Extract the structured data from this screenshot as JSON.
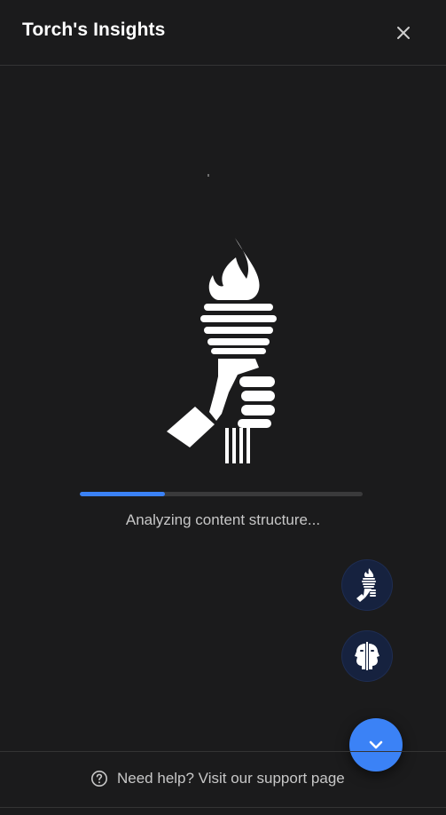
{
  "header": {
    "title": "Torch's Insights",
    "close_icon": "close-icon"
  },
  "loader": {
    "logo_icon": "torch-hand-icon",
    "progress_percent": 30,
    "status_text": "Analyzing content structure..."
  },
  "floating": {
    "avatars": [
      {
        "icon": "torch-avatar-icon"
      },
      {
        "icon": "faces-avatar-icon"
      }
    ],
    "scroll_button_icon": "chevron-down-icon"
  },
  "footer": {
    "help_icon": "help-circle-icon",
    "support_text": "Need help? Visit our support page"
  },
  "colors": {
    "background": "#1b1b1c",
    "accent": "#3b82f6",
    "avatar_bg": "#16223f",
    "muted_text": "#c7c7c7"
  }
}
